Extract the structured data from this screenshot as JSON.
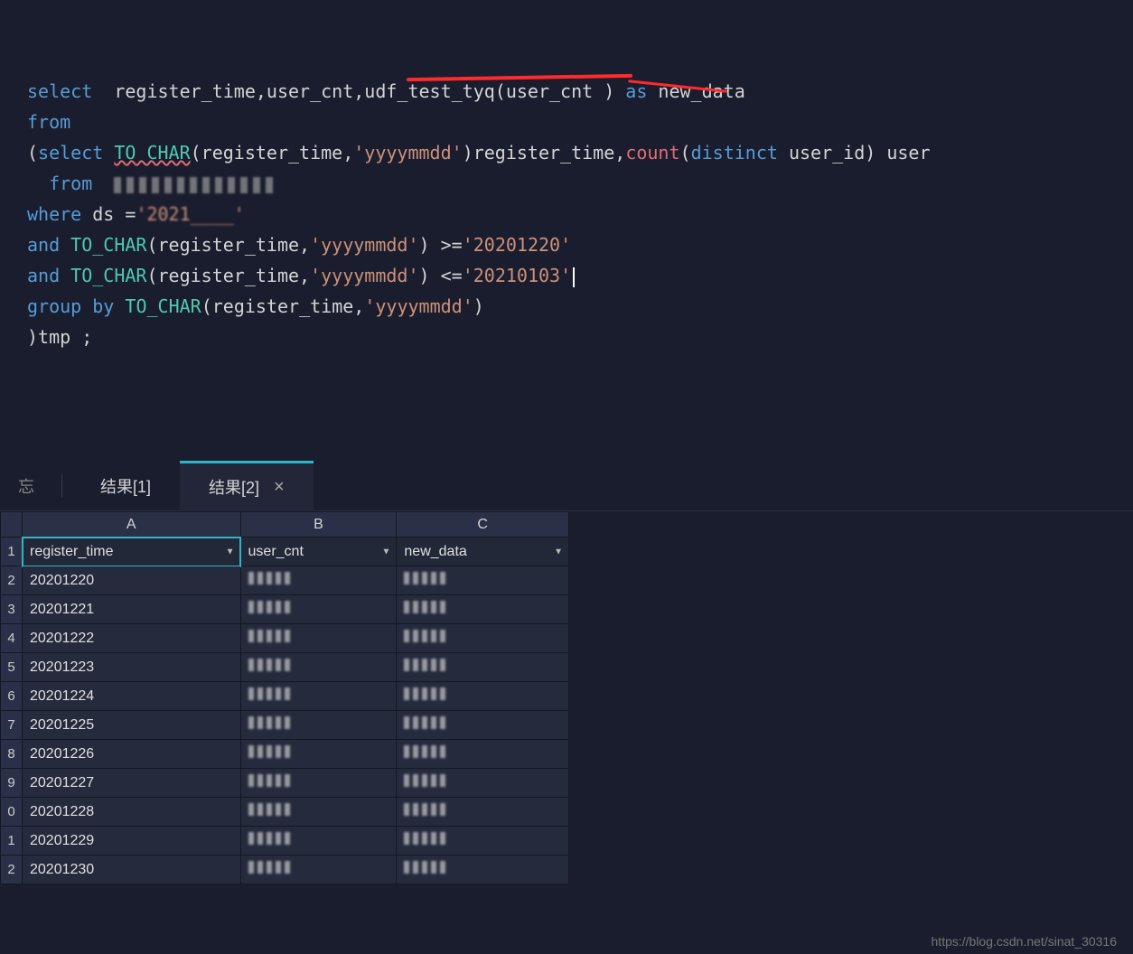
{
  "code": {
    "line1": {
      "kw_select": "select",
      "cols": "  register_time,user_cnt,",
      "udf": "udf_test_tyq",
      "arg": "(user_cnt ) ",
      "kw_as": "as",
      "alias": " new_data"
    },
    "line2": {
      "kw_from": "from"
    },
    "line3": {
      "open": "(",
      "kw_select": "select",
      "sp": " ",
      "fn": "TO CHAR",
      "args": "(register_time,",
      "str": "'yyyymmdd'",
      "close": ")register_time,",
      "count": "count",
      "open2": "(",
      "distinct": "distinct",
      "rest": " user_id) user"
    },
    "line4": {
      "kw_from": "  from  "
    },
    "line5": {
      "kw_where": "where",
      "sp": " ds =",
      "str": "'2021____'"
    },
    "line6": {
      "kw_and": "and",
      "sp": " ",
      "fn": "TO_CHAR",
      "args": "(register_time,",
      "str1": "'yyyymmdd'",
      "close": ") ",
      "op": ">=",
      "str2": "'20201220'"
    },
    "line7": {
      "kw_and": "and",
      "sp": " ",
      "fn": "TO_CHAR",
      "args": "(register_time,",
      "str1": "'yyyymmdd'",
      "close": ") ",
      "op": "<=",
      "str2": "'20210103'"
    },
    "line8": {
      "kw_group": "group",
      "sp": " ",
      "kw_by": "by",
      "sp2": " ",
      "fn": "TO_CHAR",
      "args": "(register_time,",
      "str": "'yyyymmdd'",
      "close": ")"
    },
    "line9": {
      "txt": ")tmp ;"
    }
  },
  "tabs": {
    "prefix": "忘",
    "tab1": "结果[1]",
    "tab2": "结果[2]",
    "close": "×"
  },
  "grid": {
    "col_letters": [
      "A",
      "B",
      "C"
    ],
    "headers": [
      "register_time",
      "user_cnt",
      "new_data"
    ],
    "rownums": [
      "1",
      "2",
      "3",
      "4",
      "5",
      "6",
      "7",
      "8",
      "9",
      "0",
      "1",
      "2"
    ],
    "rows": [
      {
        "a": "20201220"
      },
      {
        "a": "20201221"
      },
      {
        "a": "20201222"
      },
      {
        "a": "20201223"
      },
      {
        "a": "20201224"
      },
      {
        "a": "20201225"
      },
      {
        "a": "20201226"
      },
      {
        "a": "20201227"
      },
      {
        "a": "20201228"
      },
      {
        "a": "20201229"
      },
      {
        "a": "20201230"
      }
    ]
  },
  "watermark": "https://blog.csdn.net/sinat_30316"
}
